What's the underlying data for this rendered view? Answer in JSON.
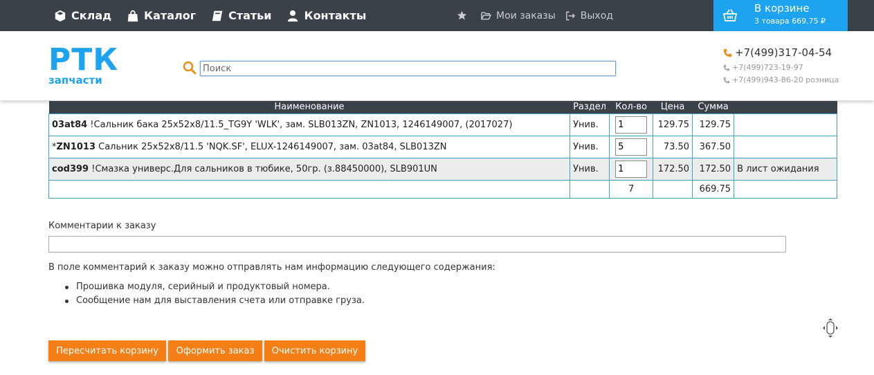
{
  "nav": {
    "items": [
      {
        "label": "Склад",
        "icon": "cube-icon"
      },
      {
        "label": "Каталог",
        "icon": "shopping-bag-icon"
      },
      {
        "label": "Статьи",
        "icon": "book-icon"
      },
      {
        "label": "Контакты",
        "icon": "user-icon"
      }
    ],
    "my_orders": "Мои заказы",
    "logout": "Выход"
  },
  "cart": {
    "title": "В корзине",
    "summary": "3 товара 669.75 ₽"
  },
  "logo": {
    "top": "РТК",
    "bottom": "запчасти"
  },
  "search": {
    "placeholder": "Поиск"
  },
  "phones": {
    "main": "+7(499)317-04-54",
    "second": "+7(499)723-19-97",
    "third": "+7(499)943-86-20 розница"
  },
  "table": {
    "headers": [
      "Наименование",
      "Раздел",
      "Кол-во",
      "Цена",
      "Сумма",
      ""
    ],
    "rows": [
      {
        "prefix": "",
        "code": "03at84",
        "desc": " !Сальник бака 25x52x8/11.5_TG9Y 'WLK', зам. SLB013ZN, ZN1013, 1246149007, (2017027)",
        "section": "Унив.",
        "qty": "1",
        "price": "129.75",
        "sum": "129.75",
        "note": ""
      },
      {
        "prefix": "*",
        "code": "ZN1013",
        "desc": " Сальник 25x52x8/11.5 'NQK.SF', ELUX-1246149007, зам. 03at84, SLB013ZN",
        "section": "Унив.",
        "qty": "5",
        "price": "73.50",
        "sum": "367.50",
        "note": ""
      },
      {
        "prefix": "",
        "code": "cod399",
        "desc": " !Смазка универс.Для сальников в тюбике, 50гр. (з.88450000), SLB901UN",
        "section": "Унив.",
        "qty": "1",
        "price": "172.50",
        "sum": "172.50",
        "note": "В лист ожидания"
      }
    ],
    "total_qty": "7",
    "total_sum": "669.75"
  },
  "comment": {
    "label": "Комментарии к заказу",
    "info": "В поле комментарий к заказу можно отправлять нам информацию следующего содержания:",
    "bullets": [
      "Прошивка модуля, серийный и продуктовый номера.",
      "Сообщение нам для выставления счета или отправке груза."
    ]
  },
  "buttons": {
    "recalc": "Пересчитать корзину",
    "checkout": "Оформить заказ",
    "clear": "Очистить корзину"
  },
  "colors": {
    "accent_blue": "#1ea3f0",
    "accent_orange": "#f47f16",
    "topbar": "#3a4149"
  }
}
